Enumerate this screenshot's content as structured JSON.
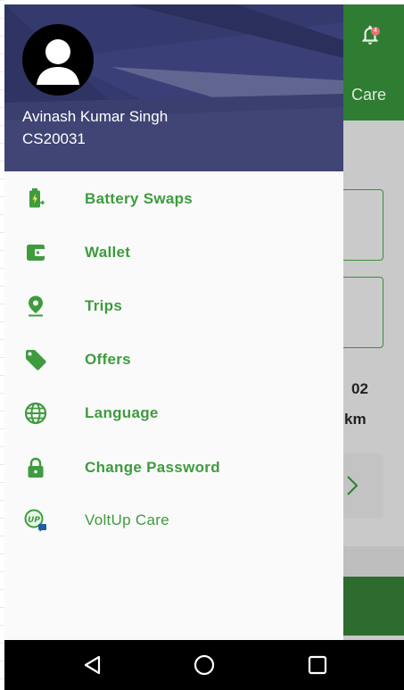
{
  "app_behind": {
    "header_care_text": "Care",
    "notification_count": "4",
    "stat_value": "02",
    "stat_unit": "km"
  },
  "drawer": {
    "user": {
      "name": "Avinash Kumar Singh",
      "id": "CS20031"
    },
    "items": [
      {
        "label": "Battery Swaps",
        "icon": "battery-swap-icon"
      },
      {
        "label": "Wallet",
        "icon": "wallet-icon"
      },
      {
        "label": "Trips",
        "icon": "location-pin-icon"
      },
      {
        "label": "Offers",
        "icon": "tag-icon"
      },
      {
        "label": "Language",
        "icon": "globe-icon"
      },
      {
        "label": "Change Password",
        "icon": "lock-icon"
      },
      {
        "label": "VoltUp Care",
        "icon": "voltup-care-icon"
      }
    ]
  },
  "navbar": {
    "buttons": [
      "back-icon",
      "home-icon",
      "recents-icon"
    ]
  },
  "colors": {
    "accent_green": "#3e9b3e",
    "drawer_header": "#2f3464",
    "app_header": "#2e7d32"
  }
}
